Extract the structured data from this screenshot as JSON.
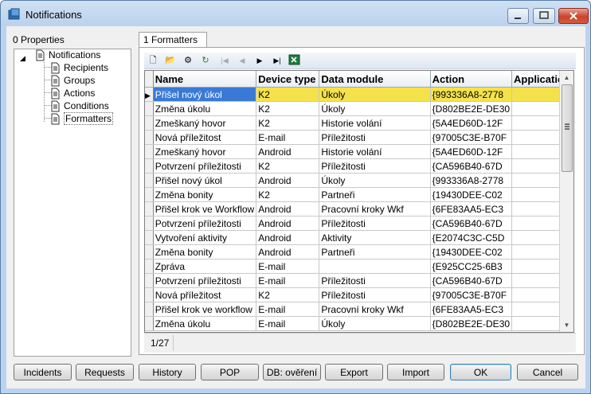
{
  "window": {
    "title": "Notifications"
  },
  "left": {
    "label": "0 Properties",
    "tree": [
      {
        "label": "Notifications",
        "level": 0
      },
      {
        "label": "Recipients",
        "level": 1
      },
      {
        "label": "Groups",
        "level": 1
      },
      {
        "label": "Actions",
        "level": 1
      },
      {
        "label": "Conditions",
        "level": 1
      },
      {
        "label": "Formatters",
        "level": 1
      }
    ]
  },
  "tab": {
    "label": "1 Formatters"
  },
  "toolbar": [
    {
      "name": "new-icon",
      "glyph": "🗋"
    },
    {
      "name": "open-icon",
      "glyph": "📂"
    },
    {
      "name": "delete-icon",
      "glyph": "⚙"
    },
    {
      "name": "refresh-icon",
      "glyph": "↻"
    },
    {
      "name": "first-icon",
      "glyph": "⏮"
    },
    {
      "name": "prev-icon",
      "glyph": "◀"
    },
    {
      "name": "next-icon",
      "glyph": "▶"
    },
    {
      "name": "last-icon",
      "glyph": "⏭"
    },
    {
      "name": "excel-icon",
      "glyph": "X"
    }
  ],
  "grid": {
    "columns": [
      "Name",
      "Device type",
      "Data module",
      "Action",
      "Application"
    ],
    "rows": [
      [
        "Přišel nový úkol",
        "K2",
        "Úkoly",
        "{993336A8-2778",
        ""
      ],
      [
        "Změna úkolu",
        "K2",
        "Úkoly",
        "{D802BE2E-DE30",
        ""
      ],
      [
        "Zmeškaný hovor",
        "K2",
        "Historie volání",
        "{5A4ED60D-12F",
        ""
      ],
      [
        "Nová příležitost",
        "E-mail",
        "Příležitosti",
        "{97005C3E-B70F",
        ""
      ],
      [
        "Zmeškaný hovor",
        "Android",
        "Historie volání",
        "{5A4ED60D-12F",
        ""
      ],
      [
        "Potvrzení příležitosti",
        "K2",
        "Příležitosti",
        "{CA596B40-67D",
        ""
      ],
      [
        "Přišel nový úkol",
        "Android",
        "Úkoly",
        "{993336A8-2778",
        ""
      ],
      [
        "Změna bonity",
        "K2",
        "Partneři",
        "{19430DEE-C02",
        ""
      ],
      [
        "Přišel krok ve Workflow",
        "Android",
        "Pracovní kroky Wkf",
        "{6FE83AA5-EC3",
        ""
      ],
      [
        "Potvrzení příležitosti",
        "Android",
        "Příležitosti",
        "{CA596B40-67D",
        ""
      ],
      [
        "Vytvoření aktivity",
        "Android",
        "Aktivity",
        "{E2074C3C-C5D",
        ""
      ],
      [
        "Změna bonity",
        "Android",
        "Partneři",
        "{19430DEE-C02",
        ""
      ],
      [
        "Zpráva",
        "E-mail",
        "",
        "{E925CC25-6B3",
        ""
      ],
      [
        "Potvrzení příležitosti",
        "E-mail",
        "Příležitosti",
        "{CA596B40-67D",
        ""
      ],
      [
        "Nová příležitost",
        "K2",
        "Příležitosti",
        "{97005C3E-B70F",
        ""
      ],
      [
        "Přišel krok ve workflow",
        "E-mail",
        "Pracovní kroky Wkf",
        "{6FE83AA5-EC3",
        ""
      ],
      [
        "Změna úkolu",
        "E-mail",
        "Úkoly",
        "{D802BE2E-DE30",
        ""
      ]
    ],
    "pager": "1/27"
  },
  "buttons": [
    "Incidents",
    "Requests",
    "History",
    "POP",
    "DB: ověření",
    "Export",
    "Import",
    "OK",
    "Cancel"
  ]
}
